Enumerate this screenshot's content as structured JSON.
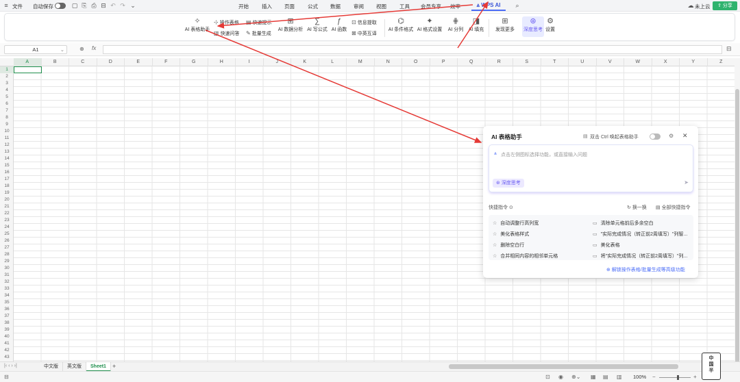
{
  "topbar": {
    "file": "文件",
    "autosave": "自动保存",
    "tabs": [
      "开始",
      "插入",
      "页面",
      "公式",
      "数据",
      "审阅",
      "视图",
      "工具",
      "会员专享",
      "效率"
    ],
    "wps_ai": "WPS AI",
    "cloud": "未上云",
    "share": "分享"
  },
  "ribbon": {
    "ai_table_helper": "AI 表格助手",
    "op_table": "操作表格",
    "fast_fill": "快速提示",
    "fast_ask": "快速问答",
    "batch_gen": "批量生成",
    "ai_data_analysis": "AI 数据分析",
    "ai_write_formula": "AI 写公式",
    "ai_function": "AI 函数",
    "info_extract": "信息提取",
    "cn_en_translate": "中英互译",
    "ai_conditional_format": "AI 条件格式",
    "ai_format_settings": "AI 格式设置",
    "ai_split": "AI 分列",
    "ai_fill": "AI 填充",
    "discover_more": "发现更多",
    "deep_think": "深度思考",
    "settings": "设置"
  },
  "formula_bar": {
    "cell_ref": "A1",
    "fx": "fx",
    "value": ""
  },
  "columns": [
    "A",
    "B",
    "C",
    "D",
    "E",
    "F",
    "G",
    "H",
    "I",
    "J",
    "K",
    "L",
    "M",
    "N",
    "O",
    "P",
    "Q",
    "R",
    "S",
    "T",
    "U",
    "V",
    "W",
    "X",
    "Y",
    "Z"
  ],
  "rows": [
    "1",
    "2",
    "3",
    "4",
    "5",
    "6",
    "7",
    "8",
    "9",
    "10",
    "11",
    "12",
    "13",
    "14",
    "15",
    "16",
    "17",
    "18",
    "19",
    "20",
    "21",
    "22",
    "23",
    "24",
    "25",
    "26",
    "27",
    "28",
    "29",
    "30",
    "31",
    "32",
    "33",
    "34",
    "35",
    "36",
    "37",
    "38",
    "39",
    "40",
    "41",
    "42",
    "43"
  ],
  "sheet_tabs": [
    "中文版",
    "英文版",
    "Sheet1"
  ],
  "active_sheet": "Sheet1",
  "status": {
    "zoom": "100%"
  },
  "panel": {
    "title": "AI 表格助手",
    "double_ctrl": "双击 Ctrl 唤起表格助手",
    "placeholder": "点击左侧图标选择功能，或直接输入问题",
    "deep_think": "深度思考",
    "quick_label": "快捷指令",
    "refresh": "换一换",
    "all_quick": "全部快捷指令",
    "left_items": [
      "自动调整行高列宽",
      "美化表格样式",
      "删除空白行",
      "合并相同内容的相邻单元格"
    ],
    "right_items": [
      "清除单元格前后多余空白",
      "\"实际完成情况（转正前2周填写）\"列智...",
      "美化表格",
      "将\"实际完成情况（转正前2周填写）\"列..."
    ],
    "more": "解锁操作表格/批量生成等高级功能"
  },
  "sticker": [
    "中",
    "国",
    "半"
  ],
  "colors": {
    "accent": "#4a6cf7",
    "arrow": "#e53935",
    "share": "#2fb36e",
    "selection": "#1e8e4c"
  }
}
